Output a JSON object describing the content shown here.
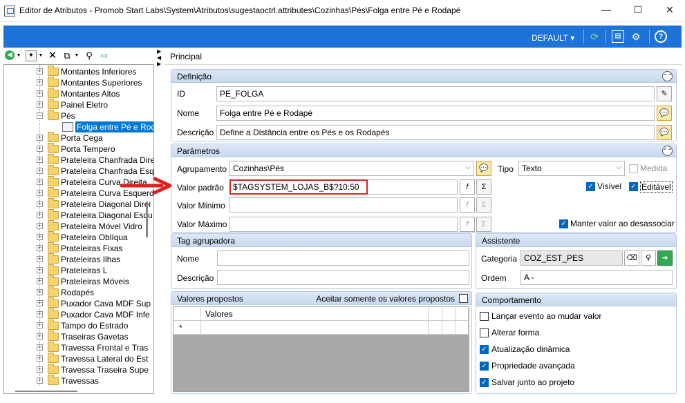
{
  "window": {
    "title": "Editor de Atributos - Promob Start Labs\\System\\Atributos\\sugestaoctrl.attributes\\Cozinhas\\Pés\\Folga entre Pé e Rodapé",
    "minimize": "—",
    "maximize": "☐",
    "close": "✕"
  },
  "toolbar": {
    "profile_label": "DEFAULT ▾",
    "icons": [
      "refresh-icon",
      "panel-icon",
      "settings-icon",
      "help-icon"
    ]
  },
  "tree": {
    "items": [
      "Montantes Inferiores",
      "Montantes Superiores",
      "Montantes Altos",
      "Painel Eletro",
      "Pés",
      "Folga entre Pé e Rodapé",
      "Porta Cega",
      "Porta Tempero",
      "Prateleira Chanfrada Dire",
      "Prateleira Chanfrada Esq",
      "Prateleira Curva Direita",
      "Prateleira Curva Esquerd",
      "Prateleira Diagonal Direi",
      "Prateleira Diagonal Esqu",
      "Prateleira Móvel Vidro",
      "Prateleira Oblíqua",
      "Prateleiras Fixas",
      "Prateleiras Ilhas",
      "Prateleiras L",
      "Prateleiras Móveis",
      "Rodapés",
      "Puxador Cava MDF Sup",
      "Puxador Cava MDF Infe",
      "Tampo do Estrado",
      "Traseiras Gavetas",
      "Travessa Frontal e Tras",
      "Travessa Lateral do Est",
      "Travessa Traseira Supe",
      "Travessas"
    ]
  },
  "main": {
    "tab": "Principal",
    "definicao": {
      "title": "Definição",
      "id_label": "ID",
      "id_value": "PE_FOLGA",
      "nome_label": "Nome",
      "nome_value": "Folga entre Pé e Rodapé",
      "descricao_label": "Descrição",
      "descricao_value": "Define a Distância entre os Pés e os Rodapés"
    },
    "parametros": {
      "title": "Parâmetros",
      "agrupamento_label": "Agrupamento",
      "agrupamento_value": "Cozinhas\\Pés",
      "tipo_label": "Tipo",
      "tipo_value": "Texto",
      "medida_label": "Medida",
      "valor_padrao_label": "Valor padrão",
      "valor_padrao_value": "$TAGSYSTEM_LOJAS_B$?10:50",
      "visivel_label": "Visível",
      "editavel_label": "Editável",
      "valor_minimo_label": "Valor Mínimo",
      "valor_maximo_label": "Valor Máximo",
      "manter_label": "Manter valor ao desassociar"
    },
    "tag": {
      "title": "Tag agrupadora",
      "nome_label": "Nome",
      "descricao_label": "Descrição"
    },
    "assistente": {
      "title": "Assistente",
      "categoria_label": "Categoria",
      "categoria_value": "COZ_EST_PES",
      "ordem_label": "Ordem",
      "ordem_value": "A -"
    },
    "valores": {
      "title": "Valores propostos",
      "aceitar_label": "Aceitar somente os valores propostos",
      "col_header": "Valores",
      "new_row_marker": "*"
    },
    "comportamento": {
      "title": "Comportamento",
      "options": [
        {
          "label": "Lançar evento ao mudar valor",
          "checked": false
        },
        {
          "label": "Alterar forma",
          "checked": false
        },
        {
          "label": "Atualização dinâmica",
          "checked": true
        },
        {
          "label": "Propriedade avançada",
          "checked": true
        },
        {
          "label": "Salvar junto ao projeto",
          "checked": true
        }
      ]
    }
  }
}
